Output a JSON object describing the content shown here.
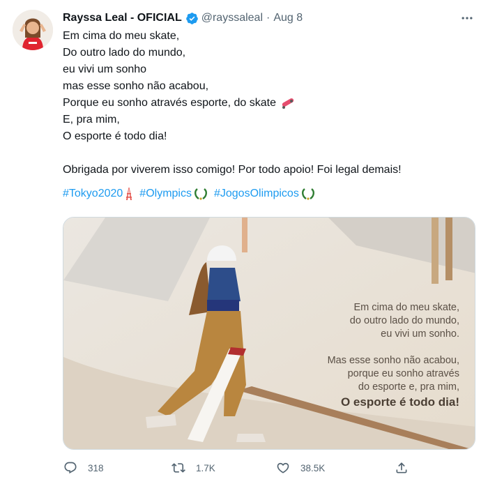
{
  "tweet": {
    "display_name": "Rayssa Leal - OFICIAL",
    "handle": "@rayssaleal",
    "separator": "·",
    "date": "Aug 8",
    "lines": [
      "Em cima do meu skate,",
      "Do outro lado do mundo,",
      "eu vivi um sonho",
      "mas esse sonho não acabou,",
      "Porque eu sonho através esporte, do skate",
      "E, pra mim,",
      "O esporte é todo dia!"
    ],
    "line_after": "Obrigada por viverem isso comigo! Por todo apoio! Foi legal demais!",
    "hashtags": [
      "#Tokyo2020",
      "#Olympics",
      "#JogosOlimpicos"
    ]
  },
  "media": {
    "overlay_lines": [
      "Em cima do meu skate,",
      "do outro lado do mundo,",
      "eu vivi um sonho.",
      "Mas esse sonho não acabou,",
      "porque eu sonho através",
      "do esporte e, pra mim,",
      "O esporte é todo dia!"
    ]
  },
  "actions": {
    "replies": "318",
    "retweets": "1.7K",
    "likes": "38.5K"
  },
  "icons": {
    "verified": "verified-badge-icon",
    "more": "more-options-icon",
    "reply": "reply-icon",
    "retweet": "retweet-icon",
    "like": "heart-icon",
    "share": "share-icon"
  },
  "colors": {
    "link": "#1d9bf0",
    "muted": "#536471",
    "text": "#0f1419"
  }
}
